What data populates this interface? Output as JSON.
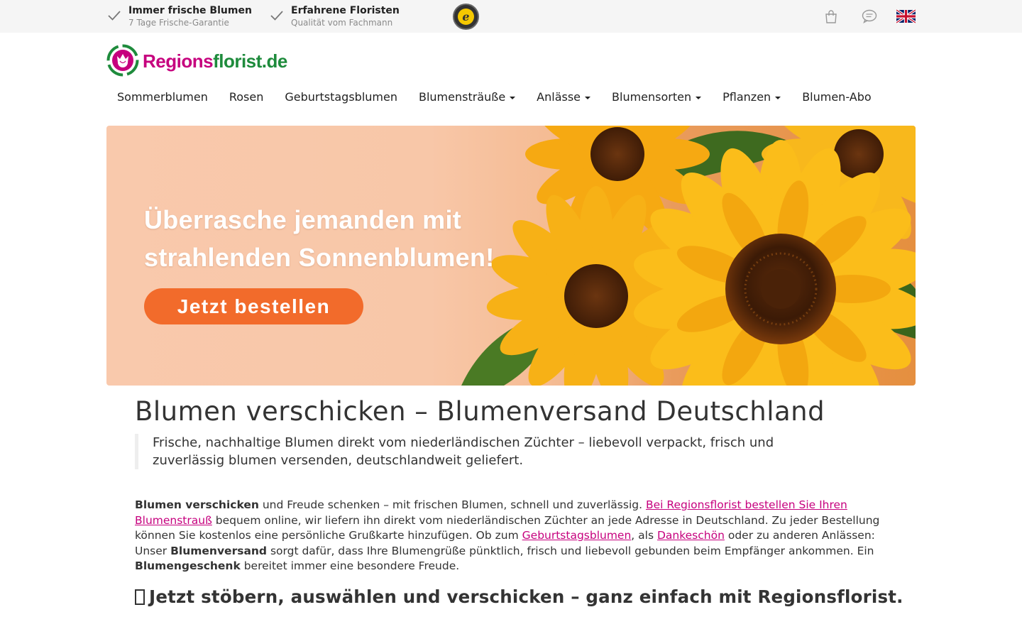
{
  "topbar": {
    "usps": [
      {
        "title": "Immer frische Blumen",
        "subtitle": "7 Tage Frische-Garantie"
      },
      {
        "title": "Erfahrene Floristen",
        "subtitle": "Qualität vom Fachmann"
      }
    ],
    "icons": [
      "check-icon",
      "trusted-shops-badge",
      "shopping-bag-icon",
      "chat-icon",
      "uk-flag-icon"
    ]
  },
  "logo": {
    "part1": "Regions",
    "part2": "florist.de"
  },
  "nav": {
    "items": [
      {
        "label": "Sommerblumen",
        "dropdown": false
      },
      {
        "label": "Rosen",
        "dropdown": false
      },
      {
        "label": "Geburtstagsblumen",
        "dropdown": false
      },
      {
        "label": "Blumensträuße",
        "dropdown": true
      },
      {
        "label": "Anlässe",
        "dropdown": true
      },
      {
        "label": "Blumensorten",
        "dropdown": true
      },
      {
        "label": "Pflanzen",
        "dropdown": true
      },
      {
        "label": "Blumen-Abo",
        "dropdown": false
      }
    ]
  },
  "banner": {
    "line1": "Überrasche jemanden mit",
    "line2": "strahlenden Sonnenblumen!",
    "button": "Jetzt bestellen"
  },
  "content": {
    "title": "Blumen verschicken – Blumenversand Deutschland",
    "quote": "Frische, nachhaltige Blumen direkt vom niederländischen Züchter – liebevoll verpackt, frisch und zuverlässig blumen versenden, deutschlandweit geliefert.",
    "para": {
      "b1": "Blumen verschicken",
      "t1": " und Freude schenken – mit frischen Blumen, schnell und zuverlässig. ",
      "link1": "Bei Regionsflorist bestellen Sie Ihren Blumenstrauß",
      "t2": " bequem online, wir liefern ihn direkt vom niederländischen Züchter an jede Adresse in Deutschland. Zu jeder Bestellung können Sie kostenlos eine persönliche Grußkarte hinzufügen. Ob zum ",
      "link2": "Geburtstagsblumen",
      "t3": ", als ",
      "link3": "Dankeschön",
      "t4": " oder zu anderen Anlässen: Unser ",
      "b2": "Blumenversand",
      "t5": " sorgt dafür, dass Ihre Blumengrüße pünktlich, frisch und liebevoll gebunden beim Empfänger ankommen. Ein ",
      "b3": "Blumengeschenk",
      "t6": " bereitet immer eine besondere Freude."
    },
    "cta": "Jetzt stöbern, auswählen und verschicken – ganz einfach mit Regionsflorist."
  },
  "colors": {
    "brand_pink": "#c6007e",
    "brand_green": "#1e8b3c",
    "button_orange": "#f26b2b",
    "topbar_bg": "#f5f5f5"
  }
}
